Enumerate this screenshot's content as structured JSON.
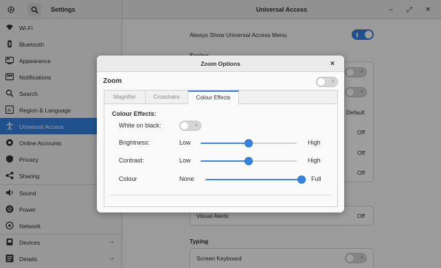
{
  "window": {
    "sidebar_title": "Settings",
    "main_title": "Universal Access"
  },
  "sidebar": {
    "items": [
      {
        "label": "Wi-Fi",
        "icon": "wifi-icon"
      },
      {
        "label": "Bluetooth",
        "icon": "bluetooth-icon"
      },
      {
        "label": "Appearance",
        "icon": "appearance-icon"
      },
      {
        "label": "Notifications",
        "icon": "bell-icon"
      },
      {
        "label": "Search",
        "icon": "search-icon"
      },
      {
        "label": "Region & Language",
        "icon": "region-icon"
      },
      {
        "label": "Universal Access",
        "icon": "accessibility-icon",
        "active": true
      },
      {
        "label": "Online Accounts",
        "icon": "accounts-icon"
      },
      {
        "label": "Privacy",
        "icon": "privacy-icon"
      },
      {
        "label": "Sharing",
        "icon": "share-icon"
      },
      {
        "label": "Sound",
        "icon": "sound-icon"
      },
      {
        "label": "Power",
        "icon": "power-icon"
      },
      {
        "label": "Network",
        "icon": "network-icon"
      },
      {
        "label": "Devices",
        "icon": "devices-icon",
        "arrow": "→"
      },
      {
        "label": "Details",
        "icon": "details-icon",
        "arrow": "→"
      }
    ]
  },
  "main": {
    "always_show_label": "Always Show Universal Access Menu",
    "always_show_on": true,
    "seeing_title": "Seeing",
    "seeing_values": [
      "",
      "",
      "Default",
      "Off",
      "Off",
      "Off"
    ],
    "visual_alerts_label": "Visual Alerts",
    "visual_alerts_value": "Off",
    "typing_title": "Typing",
    "screen_keyboard_label": "Screen Keyboard",
    "screen_keyboard_on": false
  },
  "dialog": {
    "title": "Zoom Options",
    "close_glyph": "×",
    "zoom_label": "Zoom",
    "zoom_on": false,
    "tabs": [
      "Magnifier",
      "Crosshairs",
      "Colour Effects"
    ],
    "active_tab": 2,
    "section_title": "Colour Effects:",
    "white_on_black_label": "White on black:",
    "white_on_black_on": false,
    "sliders": [
      {
        "label": "Brightness:",
        "min_label": "Low",
        "max_label": "High",
        "value": 0.5
      },
      {
        "label": "Contrast:",
        "min_label": "Low",
        "max_label": "High",
        "value": 0.5
      },
      {
        "label": "Colour",
        "min_label": "None",
        "max_label": "Full",
        "value": 1.0
      }
    ]
  },
  "colors": {
    "accent": "#3584e4",
    "active_row": "#3584e4"
  }
}
